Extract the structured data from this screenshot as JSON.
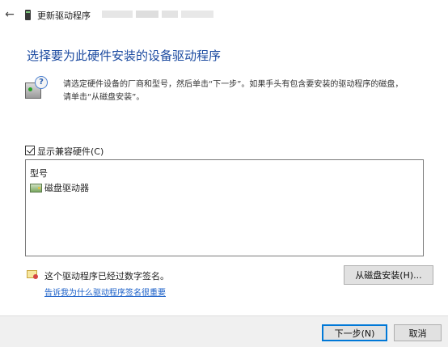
{
  "window": {
    "back_glyph": "←",
    "title": "更新驱动程序"
  },
  "main": {
    "heading": "选择要为此硬件安装的设备驱动程序",
    "description_line1": "请选定硬件设备的厂商和型号，然后单击“下一步”。如果手头有包含要安装的驱动程序的磁盘，",
    "description_line2": "请单击“从磁盘安装”。",
    "info_icon_glyph": "?"
  },
  "compat": {
    "checked": true,
    "label": "显示兼容硬件(C)"
  },
  "model_list": {
    "header": "型号",
    "items": [
      {
        "label": "磁盘驱动器",
        "icon": "disk-drive-icon"
      }
    ]
  },
  "signature": {
    "text": "这个驱动程序已经过数字签名。",
    "link": "告诉我为什么驱动程序签名很重要"
  },
  "buttons": {
    "have_disk": "从磁盘安装(H)...",
    "next": "下一步(N)",
    "cancel": "取消"
  },
  "colors": {
    "heading": "#1b4aa0",
    "link": "#1a5fc8",
    "primary_border": "#0078d7",
    "footer_bg": "#f0f0f0"
  }
}
